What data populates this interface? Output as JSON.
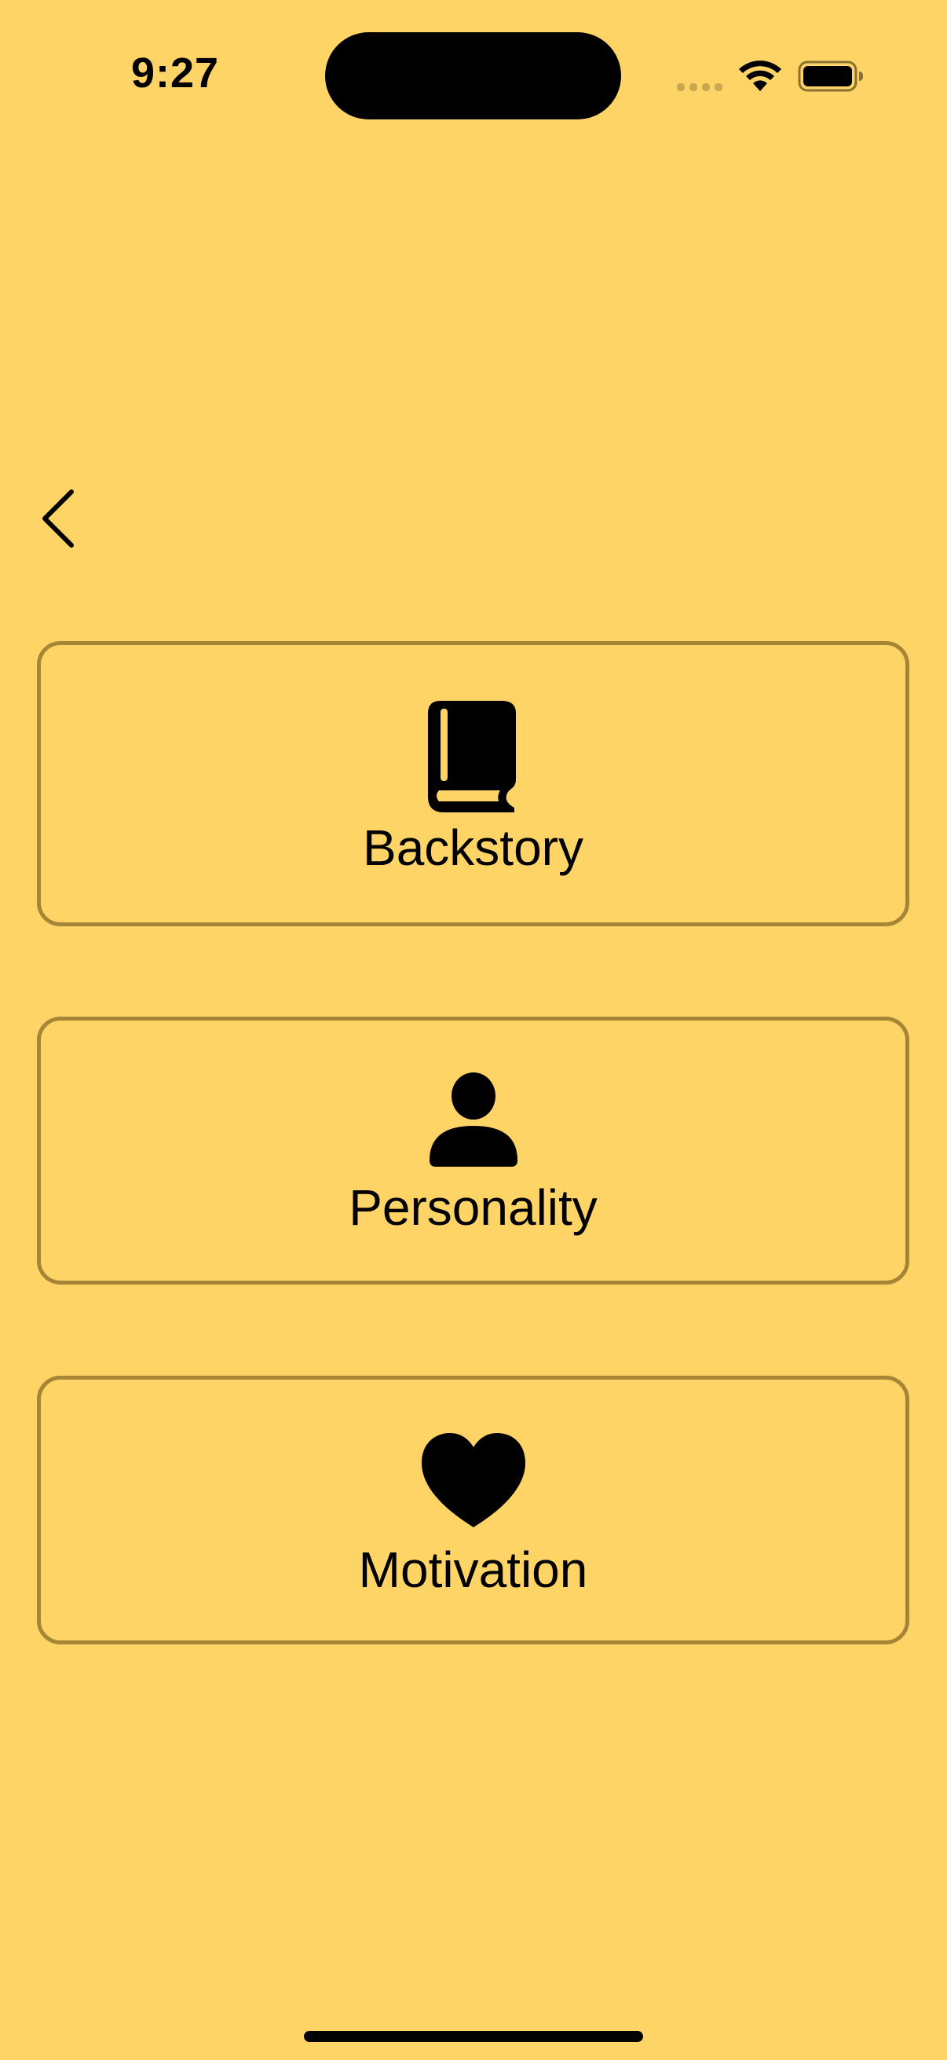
{
  "status_bar": {
    "time": "9:27"
  },
  "navigation": {
    "back_icon": "chevron-left-icon"
  },
  "menu": {
    "items": [
      {
        "label": "Backstory",
        "icon": "book-icon"
      },
      {
        "label": "Personality",
        "icon": "person-icon"
      },
      {
        "label": "Motivation",
        "icon": "heart-icon"
      }
    ]
  },
  "colors": {
    "background": "#FFD466",
    "card_border": "#A68536",
    "foreground": "#000000"
  }
}
